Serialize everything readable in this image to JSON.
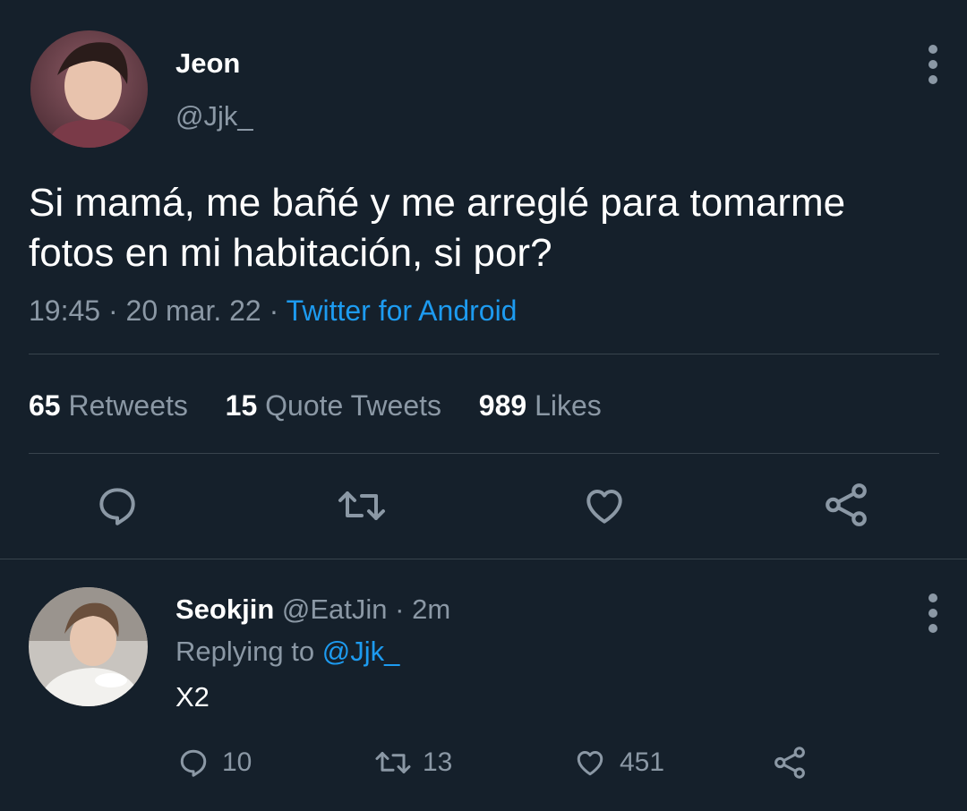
{
  "tweet": {
    "author_name": "Jeon",
    "author_handle": "@Jjk_",
    "text_line1": "Si mamá, me bañé y me arreglé para tomarme",
    "text_line2": "fotos en mi habitación, si por?",
    "time": "19:45",
    "date": "20 mar. 22",
    "separator": "·",
    "source": "Twitter for Android",
    "stats": {
      "retweets_count": "65",
      "retweets_label": "Retweets",
      "quotes_count": "15",
      "quotes_label": "Quote Tweets",
      "likes_count": "989",
      "likes_label": "Likes"
    },
    "actions": [
      "reply-icon",
      "retweet-icon",
      "like-icon",
      "share-icon"
    ]
  },
  "reply": {
    "author_name": "Seokjin",
    "author_handle": "@EatJin",
    "time": "2m",
    "separator": "·",
    "replying_prefix": "Replying to",
    "replying_to": "@Jjk_",
    "text": "X2",
    "reply_count": "10",
    "retweet_count": "13",
    "like_count": "451"
  },
  "colors": {
    "background": "#15202b",
    "text": "#ffffff",
    "muted": "#8b98a5",
    "link": "#1d9bf0",
    "divider": "#38444d"
  }
}
